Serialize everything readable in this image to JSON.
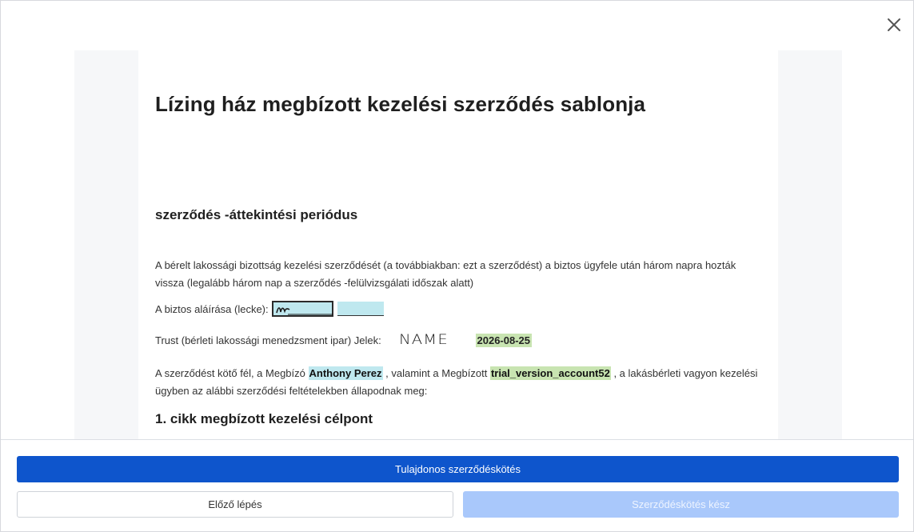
{
  "dialog": {
    "close_icon": "close-icon"
  },
  "document": {
    "title": "Lízing ház megbízott kezelési szerződés sablonja",
    "section_heading": "szerződés -áttekintési periódus",
    "paragraph1": "A bérelt lakossági bizottság kezelési szerződését (a továbbiakban: ezt a szerződést) a biztos ügyfele után három napra hozták vissza (legalább három nap a szerződés -felülvizsgálati időszak alatt)",
    "signature_label": "A biztos aláírása (lecke):",
    "signature_blank": "________",
    "trust_label": "Trust (bérleti lakossági menedzsment ipar) Jelek:",
    "trust_name": "NAME",
    "trust_date": "2026-08-25",
    "paragraph2_part1": "A szerződést kötő fél, a Megbízó",
    "principal_name": "Anthony Perez",
    "paragraph2_part2": ", valamint a Megbízott",
    "agent_name": "trial_version_account52",
    "paragraph2_part3": ", a lakásbérleti vagyon kezelési ügyben az alábbi szerződési feltételekben állapodnak meg:",
    "article1_heading": "1. cikk megbízott kezelési célpont"
  },
  "footer": {
    "primary_label": "Tulajdonos szerződéskötés",
    "previous_label": "Előző lépés",
    "done_label": "Szerződéskötés kész"
  },
  "colors": {
    "primary": "#0e55cc",
    "disabled": "#a9c8fb",
    "highlight_cyan": "#bfe8ef",
    "highlight_green": "#c8e4b1"
  }
}
